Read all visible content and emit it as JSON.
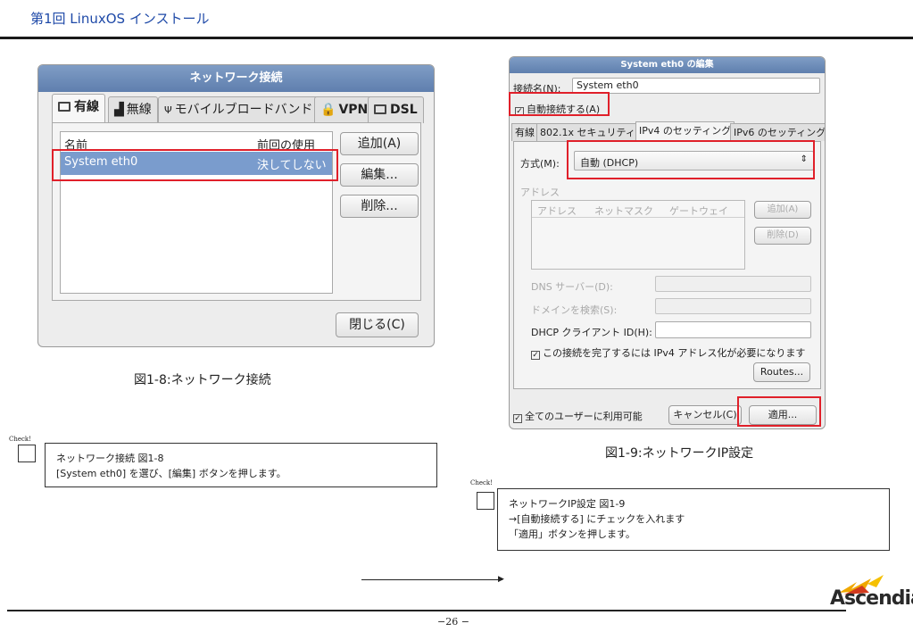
{
  "header": {
    "title": "第1回 LinuxOS インストール"
  },
  "left_dialog": {
    "title": "ネットワーク接続",
    "tabs": [
      "有線",
      "無線",
      "モバイルブロードバンド",
      "VPN",
      "DSL"
    ],
    "columns": {
      "name": "名前",
      "last_used": "前回の使用"
    },
    "row": {
      "name": "System eth0",
      "last_used": "決してしない"
    },
    "buttons": {
      "add": "追加(A)",
      "edit": "編集...",
      "delete": "削除...",
      "close": "閉じる(C)"
    }
  },
  "left_caption": "図1-8:ネットワーク接続",
  "right_dialog": {
    "title": "System eth0 の編集",
    "conn_name_label": "接続名(N):",
    "conn_name_value": "System eth0",
    "auto_connect": "自動接続する(A)",
    "tabs": [
      "有線",
      "802.1x セキュリティ",
      "IPv4 のセッティング",
      "IPv6 のセッティング"
    ],
    "method_label": "方式(M):",
    "method_value": "自動 (DHCP)",
    "address_section": "アドレス",
    "address_columns": [
      "アドレス",
      "ネットマスク",
      "ゲートウェイ"
    ],
    "add_btn": "追加(A)",
    "delete_btn": "削除(D)",
    "dns_label": "DNS サーバー(D):",
    "search_label": "ドメインを検索(S):",
    "dhcp_label": "DHCP クライアント ID(H):",
    "require_ipv4": "この接続を完了するには IPv4 アドレス化が必要になります",
    "routes_btn": "Routes...",
    "all_users": "全てのユーザーに利用可能",
    "cancel_btn": "キャンセル(C)",
    "apply_btn": "適用..."
  },
  "right_caption": "図1-9:ネットワークIP設定",
  "check_label": "Check!",
  "note_left": {
    "line1": "ネットワーク接続 図1-8",
    "line2": "[System eth0] を選び、[編集] ボタンを押します。"
  },
  "note_right": {
    "line1": "ネットワークIP設定 図1-9",
    "line2": "→[自動接続する] にチェックを入れます",
    "line3": "「適用」ボタンを押します。"
  },
  "footer": {
    "page": "−26 −",
    "logo": "Ascendia"
  }
}
